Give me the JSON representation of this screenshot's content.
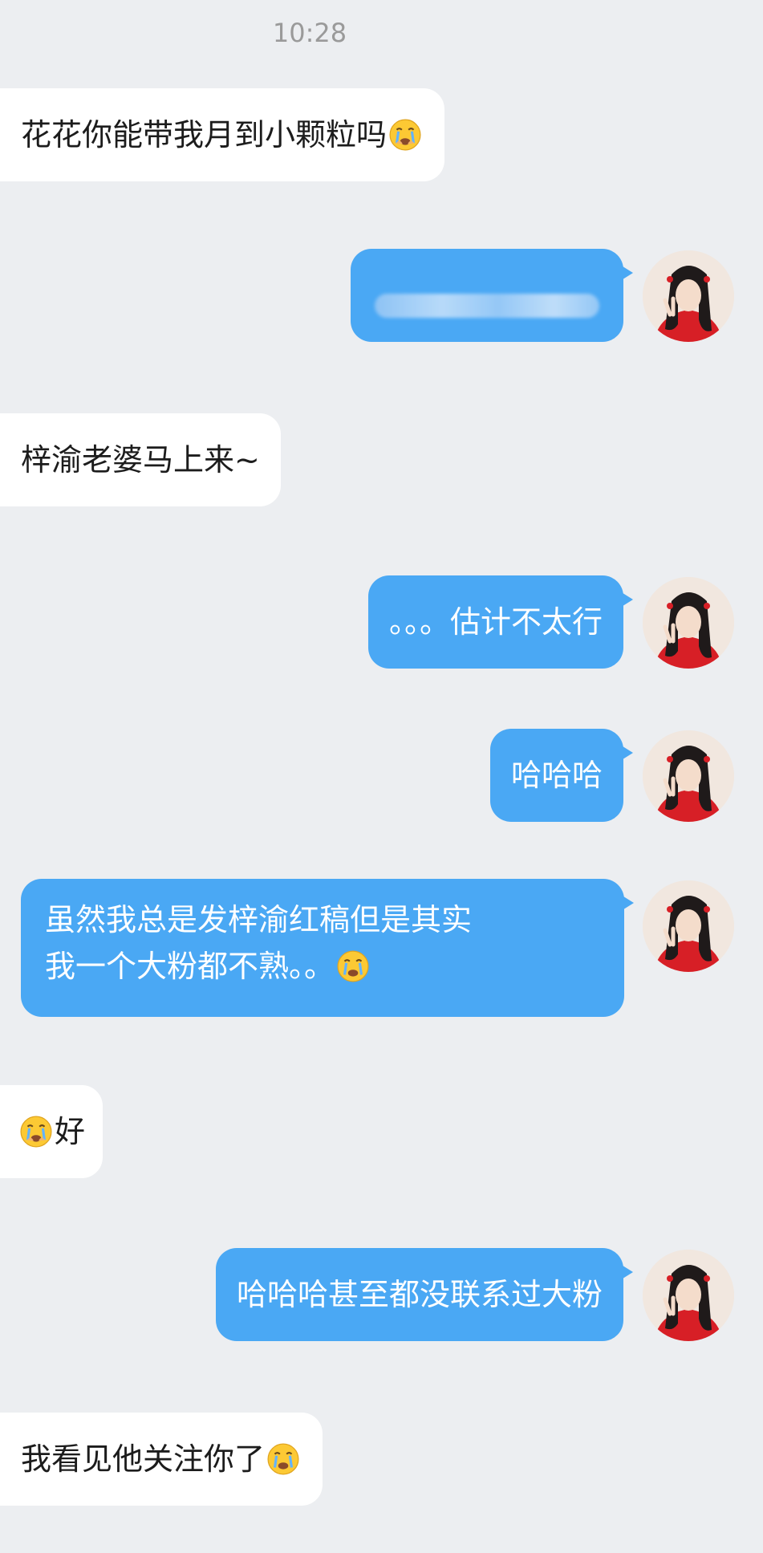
{
  "status_bar": {
    "time": "10:28"
  },
  "messages": [
    {
      "direction": "in",
      "text": "花花你能带我月到小颗粒吗",
      "emoji": "crying-face"
    },
    {
      "direction": "out",
      "text": "",
      "redacted": true
    },
    {
      "direction": "in",
      "text": "梓渝老婆马上来~"
    },
    {
      "direction": "out",
      "text": "。。。估计不太行"
    },
    {
      "direction": "out",
      "text": "哈哈哈"
    },
    {
      "direction": "out",
      "line1": "虽然我总是发梓渝红稿但是其实",
      "line2": "我一个大粉都不熟。。",
      "emoji": "crying-face"
    },
    {
      "direction": "in",
      "text": "好",
      "emoji": "crying-face"
    },
    {
      "direction": "out",
      "text": "哈哈哈甚至都没联系过大粉"
    },
    {
      "direction": "in",
      "text": "我看见他关注你了",
      "emoji": "crying-face"
    }
  ],
  "colors": {
    "background": "#eceef1",
    "incoming_bubble": "#ffffff",
    "outgoing_bubble": "#4aa8f4",
    "outgoing_text": "#ffffff",
    "incoming_text": "#1c1c1c",
    "timestamp_text": "#9a9a9a"
  }
}
